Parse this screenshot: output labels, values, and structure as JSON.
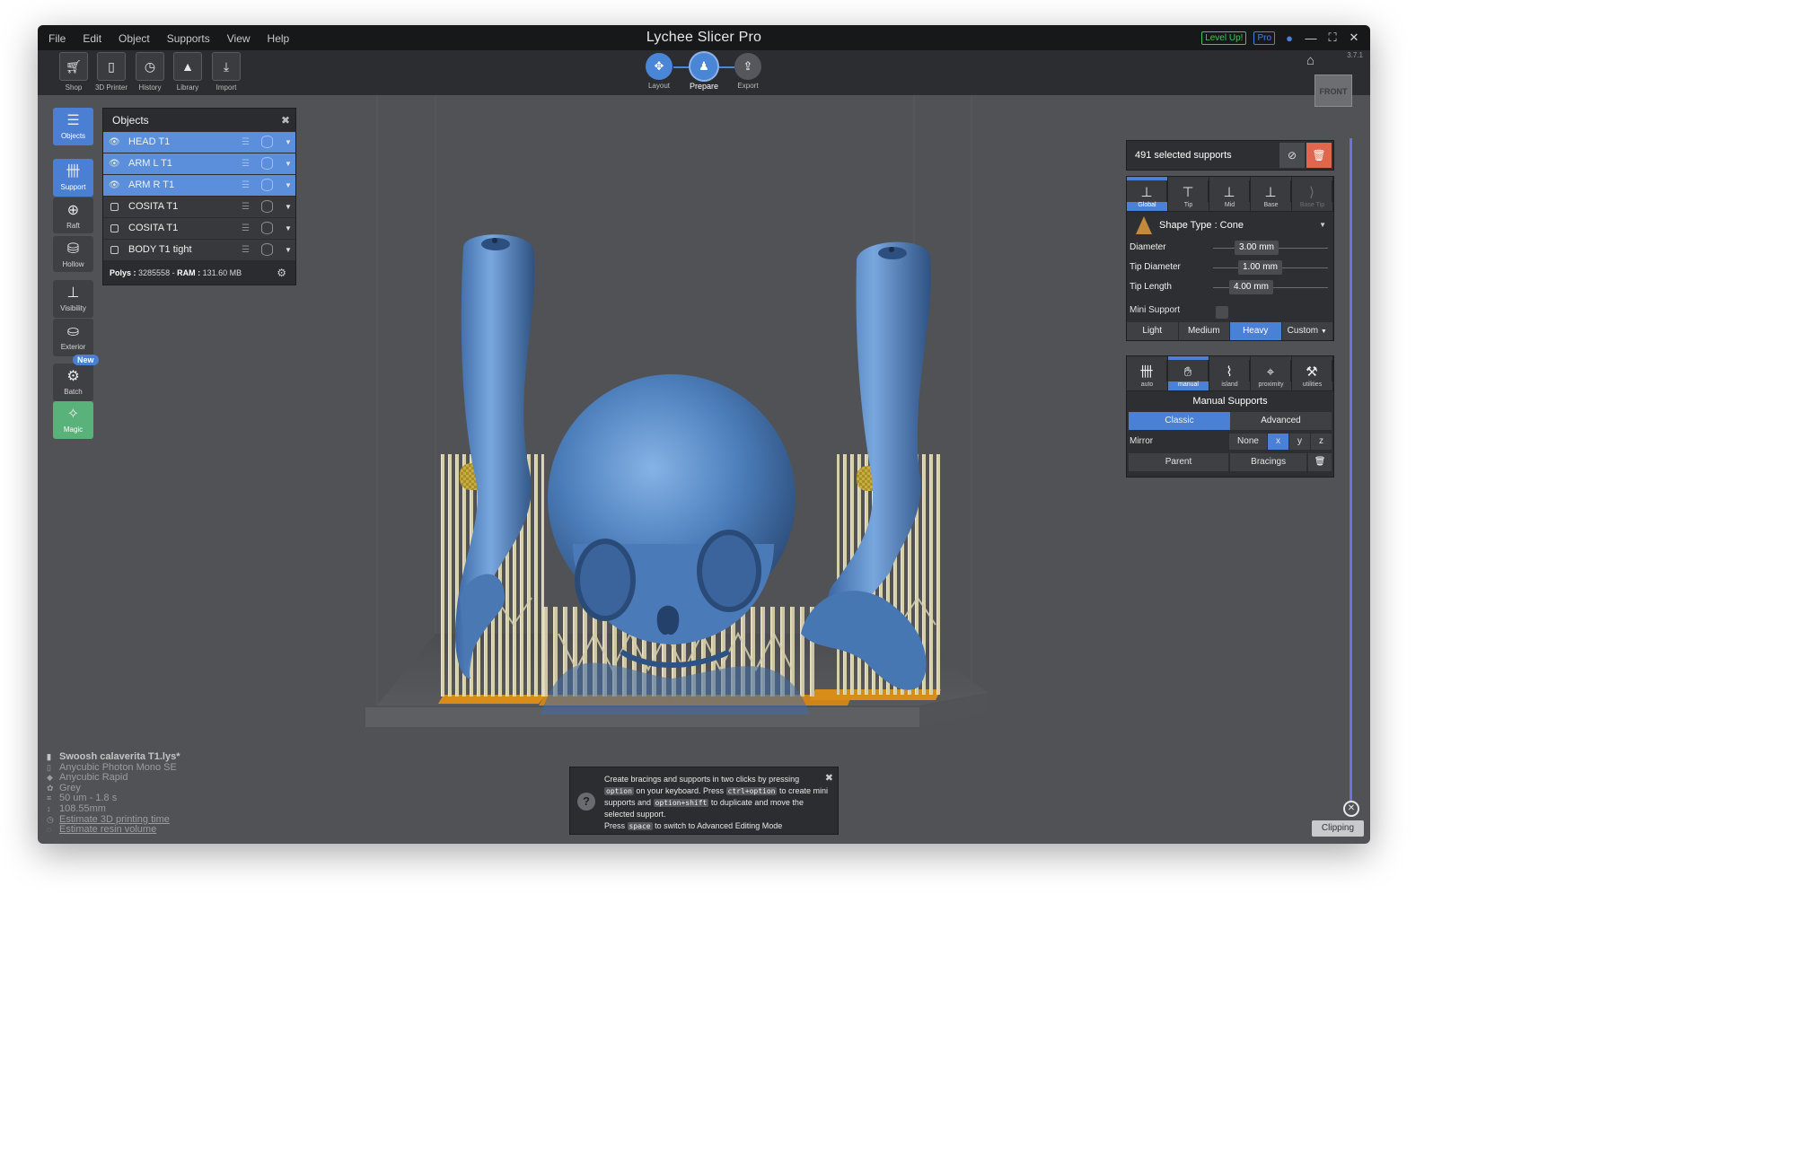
{
  "app": {
    "title": "Lychee Slicer Pro",
    "level_up": "Level Up!",
    "pro": "Pro",
    "version": "3.7.1"
  },
  "menu": [
    "File",
    "Edit",
    "Object",
    "Supports",
    "View",
    "Help"
  ],
  "toolbar": [
    {
      "label": "Shop",
      "icon": "cart-icon"
    },
    {
      "label": "3D Printer",
      "icon": "printer-icon"
    },
    {
      "label": "History",
      "icon": "history-icon"
    },
    {
      "label": "Library",
      "icon": "library-icon"
    },
    {
      "label": "Import",
      "icon": "import-icon"
    }
  ],
  "modes": {
    "layout": "Layout",
    "prepare": "Prepare",
    "export": "Export"
  },
  "viewcube": "FRONT",
  "sidebar": [
    {
      "label": "Objects",
      "icon": "list-icon"
    },
    {
      "label": "Support",
      "icon": "support-icon"
    },
    {
      "label": "Raft",
      "icon": "raft-icon"
    },
    {
      "label": "Hollow",
      "icon": "hollow-icon"
    },
    {
      "label": "Visibility",
      "icon": "visibility-icon"
    },
    {
      "label": "Exterior",
      "icon": "exterior-icon"
    },
    {
      "label": "Batch",
      "icon": "batch-icon"
    },
    {
      "label": "Magic",
      "icon": "magic-wand-icon"
    }
  ],
  "new_badge": "New",
  "objects": {
    "title": "Objects",
    "items": [
      {
        "name": "HEAD T1",
        "selected": true
      },
      {
        "name": "ARM L T1",
        "selected": true
      },
      {
        "name": "ARM R T1",
        "selected": true
      },
      {
        "name": "COSITA T1",
        "selected": false
      },
      {
        "name": "COSITA T1",
        "selected": false
      },
      {
        "name": "BODY T1 tight",
        "selected": false
      }
    ],
    "polys_label": "Polys :",
    "polys_value": "3285558",
    "ram_label": "RAM :",
    "ram_value": "131.60 MB"
  },
  "supports": {
    "selected_text": "491 selected supports",
    "tabs": [
      "Global",
      "Tip",
      "Mid",
      "Base",
      "Base Tip"
    ],
    "shape_type": "Shape Type : Cone",
    "params": [
      {
        "label": "Diameter",
        "value": "3.00 mm"
      },
      {
        "label": "Tip Diameter",
        "value": "1.00 mm"
      },
      {
        "label": "Tip Length",
        "value": "4.00 mm"
      }
    ],
    "mini_support": "Mini Support",
    "density": [
      "Light",
      "Medium",
      "Heavy",
      "Custom"
    ],
    "density_selected": "Heavy"
  },
  "manual": {
    "tabs": [
      "auto",
      "manual",
      "island",
      "proximity",
      "utilities"
    ],
    "title": "Manual Supports",
    "classic": "Classic",
    "advanced": "Advanced",
    "mirror_label": "Mirror",
    "mirror_options": [
      "None",
      "x",
      "y",
      "z"
    ],
    "mirror_selected": "x",
    "parent": "Parent",
    "bracings": "Bracings"
  },
  "file_info": {
    "filename": "Swoosh calaverita T1.lys*",
    "printer": "Anycubic Photon Mono SE",
    "resin": "Anycubic Rapid",
    "color": "Grey",
    "layer": "50 um - 1.8 s",
    "height": "108.55mm",
    "estimate_time": "Estimate 3D printing time",
    "estimate_resin": "Estimate resin volume"
  },
  "tip": {
    "l1": "Create bracings and supports in two clicks by pressing",
    "k1": "option",
    "l2": "on your keyboard. Press",
    "k2": "ctrl+option",
    "l3": "to create mini supports and",
    "k3": "option+shift",
    "l4": "to duplicate and move the selected support.",
    "l5": "Press",
    "k4": "space",
    "l6": "to switch to Advanced Editing Mode"
  },
  "clipping": "Clipping",
  "colors": {
    "accent": "#4a80d6",
    "model": "#4f7fb8",
    "support": "#d8cfae",
    "raft": "#d58a1c",
    "trash": "#e0674e"
  }
}
